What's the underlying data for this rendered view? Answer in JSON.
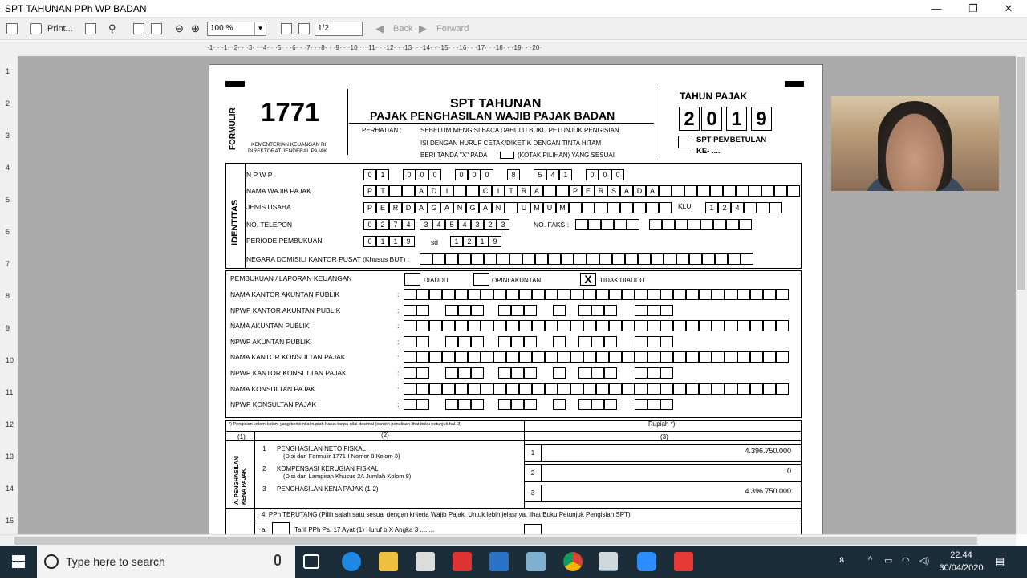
{
  "window": {
    "title": "SPT TAHUNAN PPh WP BADAN",
    "minimize": "—",
    "restore": "❐",
    "close": "✕"
  },
  "toolbar": {
    "print": "Print...",
    "zoom": "100 %",
    "page": "1/2",
    "back": "Back",
    "forward": "Forward"
  },
  "ruler": {
    "h": "·1·  ·  ·1·  ·2·  ·  ·3·  ·  ·4·  ·  ·5·  ·  ·6·  ·  ·7·  ·  ·8·  ·  ·9·  ·  ·10·  ·  ·11·  ·  ·12·  ·  ·13·  ·  ·14·  ·  ·15·  ·  ·16·  ·  ·17·  ·  ·18·  ·  ·19·  ·  ·20·",
    "v": [
      "1",
      "2",
      "3",
      "4",
      "5",
      "6",
      "7",
      "8",
      "9",
      "10",
      "11",
      "12",
      "13",
      "14",
      "15"
    ]
  },
  "form": {
    "formulir": "FORMULIR",
    "number": "1771",
    "ministry": "KEMENTERIAN KEUANGAN RI",
    "directorate": "DIREKTORAT JENDERAL PAJAK",
    "title1": "SPT TAHUNAN",
    "title2": "PAJAK PENGHASILAN WAJIB PAJAK BADAN",
    "perhatian": "PERHATIAN  :",
    "note1": "SEBELUM MENGISI BACA DAHULU BUKU PETUNJUK PENGISIAN",
    "note2": "ISI DENGAN HURUF CETAK/DIKETIK DENGAN TINTA HITAM",
    "note3": "BERI TANDA \"X\" PADA",
    "note3b": "(KOTAK PILIHAN) YANG SESUAI",
    "tahun_pajak": "TAHUN PAJAK",
    "year": [
      "2",
      "0",
      "1",
      "9"
    ],
    "pembetulan1": "SPT PEMBETULAN",
    "pembetulan2": "KE- ....",
    "identitas": "IDENTITAS",
    "npwp_label": "N P W P",
    "npwp": [
      "0",
      "1",
      "",
      "0",
      "0",
      "0",
      "",
      "0",
      "0",
      "0",
      "",
      "8",
      "",
      "5",
      "4",
      "1",
      "",
      "0",
      "0",
      "0"
    ],
    "nama_label": "NAMA WAJIB PAJAK",
    "nama": "PT  ADI  CITRA  PERSADA",
    "usaha_label": "JENIS USAHA",
    "usaha": "PERDAGANGAN UMUM",
    "klu_label": "KLU:",
    "klu": [
      "1",
      "2",
      "4"
    ],
    "telp_label": "NO. TELEPON",
    "telp": [
      "0",
      "2",
      "7",
      "4",
      "",
      "3",
      "4",
      "5",
      "4",
      "3",
      "2",
      "3"
    ],
    "fax_label": "NO. FAKS :",
    "periode_label": "PERIODE PEMBUKUAN",
    "periode_a": [
      "0",
      "1",
      "1",
      "9"
    ],
    "periode_sd": "sd",
    "periode_b": [
      "1",
      "2",
      "1",
      "9"
    ],
    "negara_label": "NEGARA DOMISILI KANTOR PUSAT (Khusus BUT) :",
    "pembukuan_label": "PEMBUKUAN / LAPORAN KEUANGAN",
    "diaudit": "DIAUDIT",
    "opini": "OPINI AKUNTAN",
    "tidak": "TIDAK DIAUDIT",
    "x_mark": "X",
    "rows": [
      "NAMA KANTOR AKUNTAN PUBLIK",
      "NPWP KANTOR AKUNTAN PUBLIK",
      "NAMA AKUNTAN PUBLIK",
      "NPWP AKUNTAN PUBLIK",
      "NAMA KANTOR KONSULTAN PAJAK",
      "NPWP KANTOR KONSULTAN PAJAK",
      "NAMA KONSULTAN PAJAK",
      "NPWP KONSULTAN PAJAK"
    ],
    "footnote": "*) Pengisian kolom-kolom yang berisi nilai rupiah harus tanpa nilai desimal (contoh penulisan lihat buku petunjuk hal. 3)",
    "rupiah": "Rupiah *)",
    "col1": "(1)",
    "col2": "(2)",
    "col3": "(3)",
    "section_a": "A. PENGHASILAN KENA PAJAK",
    "items": [
      {
        "no": "1",
        "label": "PENGHASILAN NETO FISKAL",
        "sub": "(Disi dari Formulir 1771-I Nomor 8 Kolom 3)",
        "box": "1",
        "value": "4.396.750.000"
      },
      {
        "no": "2",
        "label": "KOMPENSASI KERUGIAN FISKAL",
        "sub": "(Disi dari Lampiran Khusus 2A Jumlah Kolom 8)",
        "box": "2",
        "value": "0"
      },
      {
        "no": "3",
        "label": "PENGHASILAN KENA PAJAK  (1-2)",
        "sub": "",
        "box": "3",
        "value": "4.396.750.000"
      }
    ],
    "pph_label": "4. PPh TERUTANG (Pilih salah satu sesuai dengan kriteria Wajib Pajak. Untuk lebih jelasnya, lihat Buku Petunjuk Pengisian SPT)",
    "pph_a": "a.",
    "pph_a_text": "Tarif PPh Ps. 17 Ayat (1) Huruf b X Angka 3 ........"
  },
  "taskbar": {
    "search": "Type here to search",
    "time": "22.44",
    "date": "30/04/2020"
  }
}
